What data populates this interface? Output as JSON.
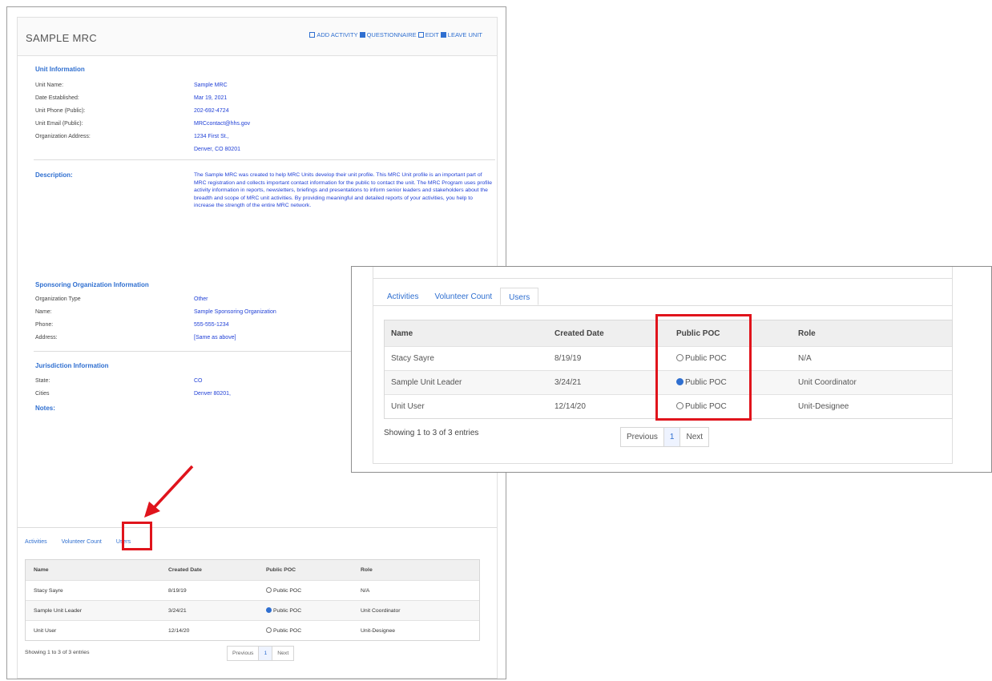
{
  "unit": {
    "title": "SAMPLE MRC",
    "actions": [
      "ADD ACTIVITY",
      "QUESTIONNAIRE",
      "EDIT",
      "LEAVE UNIT"
    ]
  },
  "unit_info": {
    "heading": "Unit Information",
    "labels": [
      "Unit Name:",
      "Date Established:",
      "Unit Phone (Public):",
      "Unit Email (Public):",
      "Organization Address:"
    ],
    "values": [
      "Sample MRC",
      "Mar 19, 2021",
      "202-692-4724",
      "MRCcontact@hhs.gov",
      "1234 First St.,",
      "Denver, CO 80201"
    ]
  },
  "description": {
    "heading": "Description:",
    "text": "The Sample MRC was created to help MRC Units develop their unit profile. This MRC Unit profile is an important part of MRC registration and collects important contact information for the public to contact the unit. The MRC Program uses profile activity information in reports, newsletters, briefings and presentations to inform senior leaders and stakeholders about the breadth and scope of MRC unit activities. By providing meaningful and detailed reports of your activities, you help to increase the strength of the entire MRC network."
  },
  "sponsor": {
    "heading": "Sponsoring Organization Information",
    "labels": [
      "Organization Type",
      "Name:",
      "Phone:",
      "Address:"
    ],
    "values": [
      "Other",
      "Sample Sponsoring Organization",
      "555-555-1234",
      "[Same as above]"
    ]
  },
  "jurisdiction": {
    "heading": "Jurisdiction Information",
    "labels": [
      "State:",
      "Cities"
    ],
    "values": [
      "CO",
      "Denver 80201,"
    ],
    "notes_label": "Notes:"
  },
  "tabs": [
    "Activities",
    "Volunteer Count",
    "Users"
  ],
  "users_table": {
    "columns": [
      "Name",
      "Created Date",
      "Public POC",
      "Role"
    ],
    "rows": [
      {
        "name": "Stacy Sayre",
        "date": "8/19/19",
        "poc": "Public POC",
        "poc_selected": false,
        "role": "N/A"
      },
      {
        "name": "Sample Unit Leader",
        "date": "3/24/21",
        "poc": "Public POC",
        "poc_selected": true,
        "role": "Unit Coordinator"
      },
      {
        "name": "Unit User",
        "date": "12/14/20",
        "poc": "Public POC",
        "poc_selected": false,
        "role": "Unit-Designee"
      }
    ],
    "showing": "Showing 1 to 3 of 3 entries",
    "pager": {
      "prev": "Previous",
      "page": "1",
      "next": "Next"
    }
  },
  "colors": {
    "link": "#2f6fd0",
    "value": "#1f3fd6",
    "highlight": "#e0141c"
  }
}
